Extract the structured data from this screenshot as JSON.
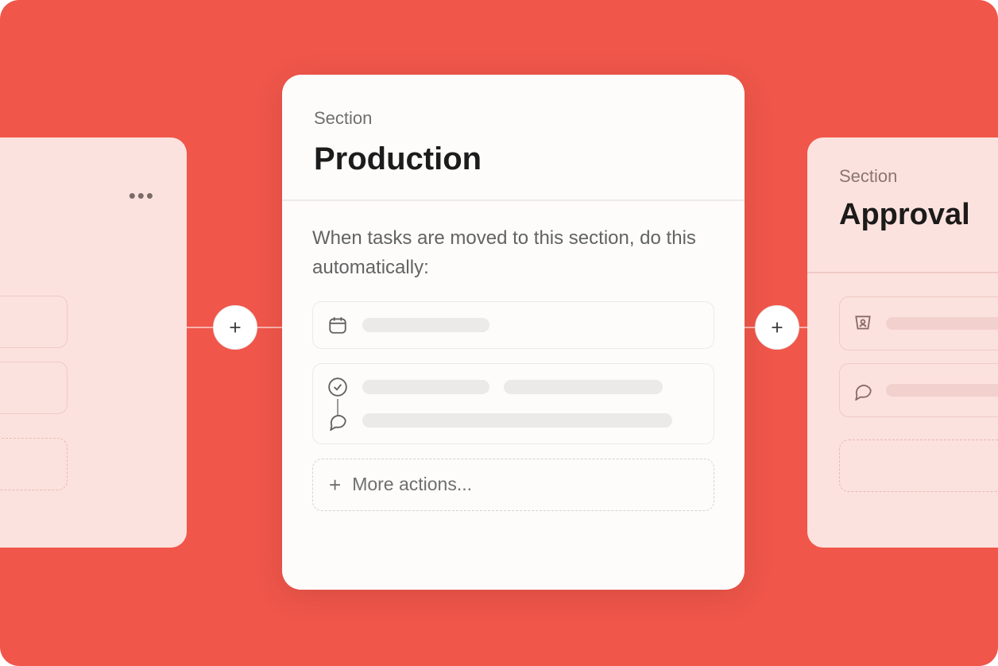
{
  "left_card": {
    "more_icon": "ellipsis"
  },
  "center_card": {
    "section_label": "Section",
    "title": "Production",
    "helper_text": "When tasks are moved to this section, do this automatically:",
    "rule1_icon": "calendar",
    "rule2_icon1": "check-circle",
    "rule2_icon2": "comment",
    "more_actions_label": "More actions..."
  },
  "right_card": {
    "section_label": "Section",
    "title": "Approval",
    "row1_icon": "assignee",
    "row2_icon": "comment"
  }
}
